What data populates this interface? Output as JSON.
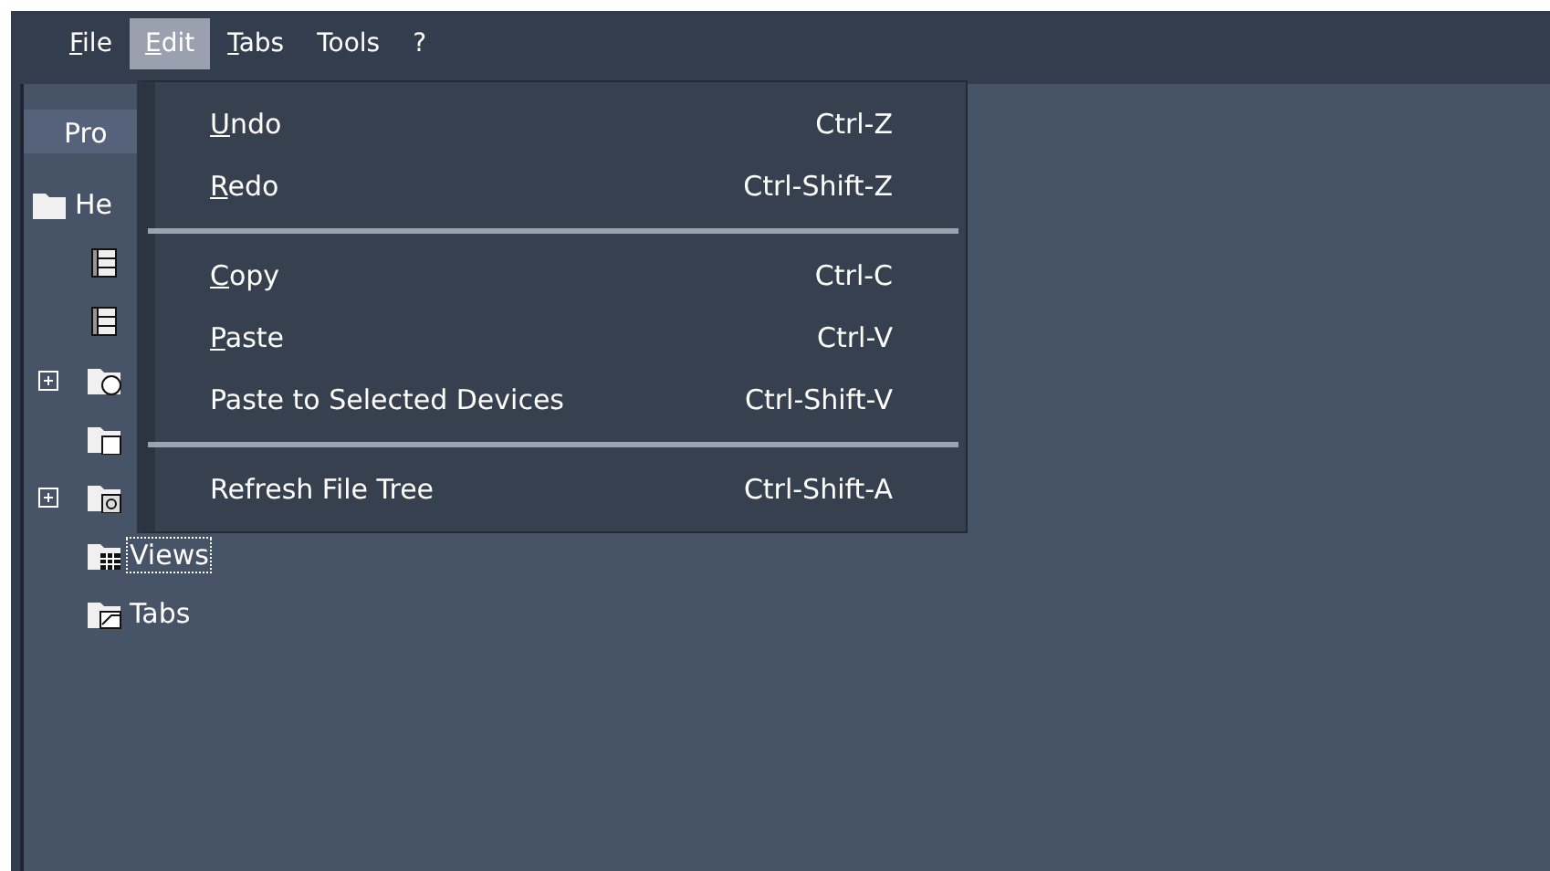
{
  "menu_bar": [
    {
      "label": "File",
      "mnemonic": true,
      "selected": false
    },
    {
      "label": "Edit",
      "mnemonic": true,
      "selected": true
    },
    {
      "label": "Tabs",
      "mnemonic": true,
      "selected": false
    },
    {
      "label": "Tools",
      "mnemonic": false,
      "selected": false
    },
    {
      "label": "?",
      "mnemonic": false,
      "selected": false
    }
  ],
  "panel": {
    "title": "Pro",
    "tree": [
      {
        "label": "He",
        "kind": "folder",
        "children": [
          {
            "kind": "film"
          },
          {
            "kind": "film"
          },
          {
            "kind": "folder-clock",
            "expanded": false
          },
          {
            "kind": "folder-doc"
          },
          {
            "kind": "folder-gear",
            "expanded": false
          },
          {
            "kind": "folder-grid",
            "label": "Views",
            "focused": true
          },
          {
            "kind": "folder-chart",
            "label": "Tabs",
            "focused": false
          }
        ]
      }
    ]
  },
  "edit_menu": [
    {
      "kind": "item",
      "label": "Undo",
      "mnemonic": true,
      "shortcut": "Ctrl-Z"
    },
    {
      "kind": "item",
      "label": "Redo",
      "mnemonic": true,
      "shortcut": "Ctrl-Shift-Z"
    },
    {
      "kind": "separator"
    },
    {
      "kind": "item",
      "label": "Copy",
      "mnemonic": true,
      "shortcut": "Ctrl-C"
    },
    {
      "kind": "item",
      "label": "Paste",
      "mnemonic": true,
      "shortcut": "Ctrl-V"
    },
    {
      "kind": "item",
      "label": "Paste to Selected Devices",
      "mnemonic": false,
      "shortcut": "Ctrl-Shift-V"
    },
    {
      "kind": "separator"
    },
    {
      "kind": "item",
      "label": "Refresh File Tree",
      "mnemonic": false,
      "shortcut": "Ctrl-Shift-A"
    }
  ]
}
